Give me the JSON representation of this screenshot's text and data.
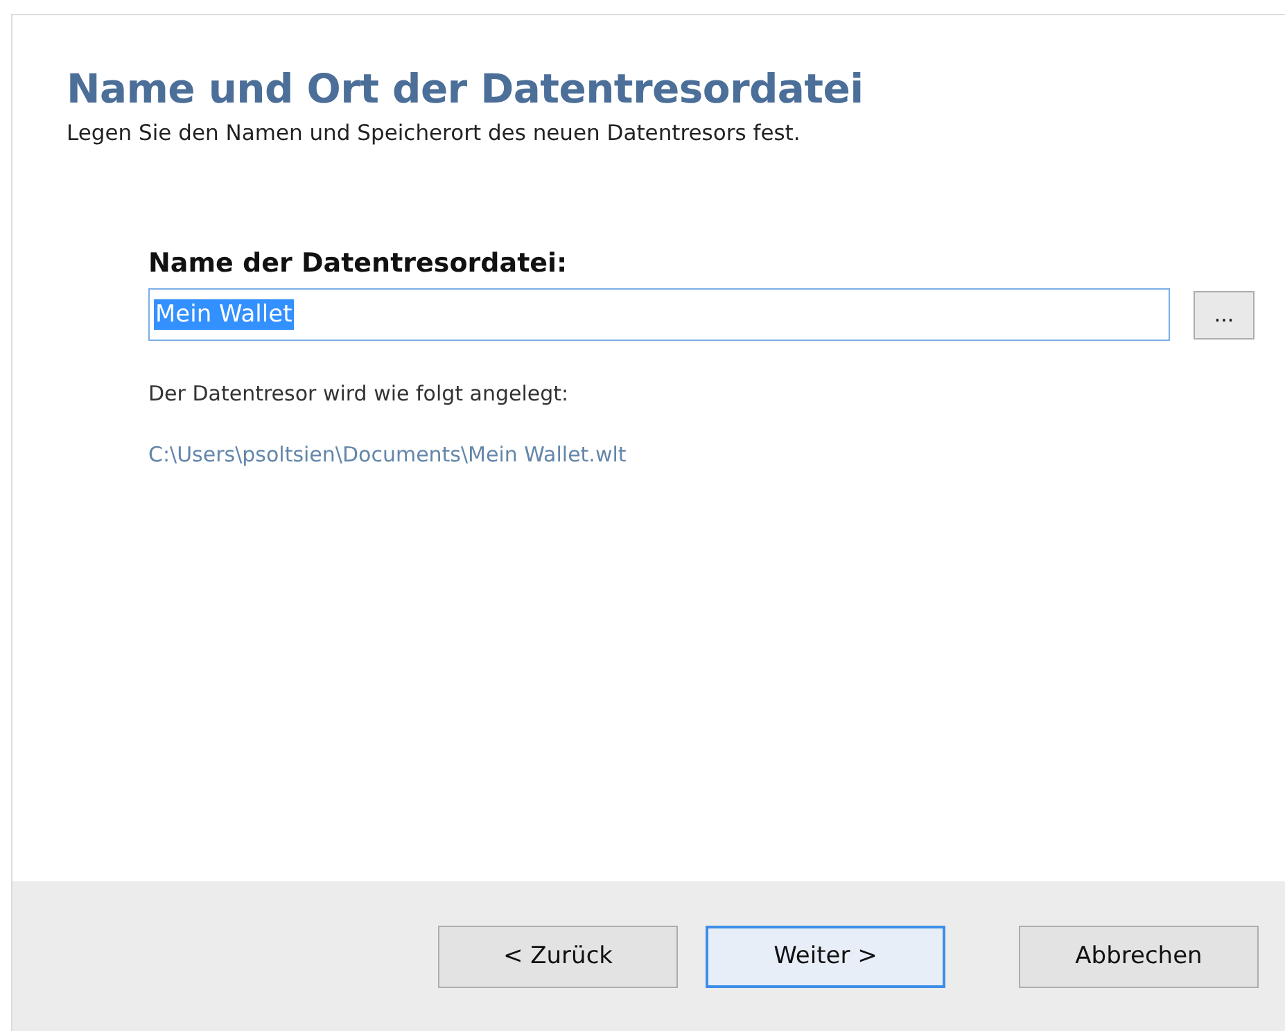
{
  "header": {
    "title": "Name und Ort der Datentresordatei",
    "subtitle": "Legen Sie den Namen und Speicherort des neuen Datentresors fest."
  },
  "form": {
    "label": "Name der Datentresordatei:",
    "field": {
      "value": "Mein Wallet",
      "text_selected": true
    },
    "browse_button": "...",
    "info": "Der Datentresor wird wie folgt angelegt:",
    "path": "C:\\Users\\psoltsien\\Documents\\Mein Wallet.wlt"
  },
  "buttons": [
    {
      "label": "< Zurück",
      "focused": false
    },
    {
      "label": "Weiter >",
      "focused": true
    },
    {
      "label": "Abbrechen",
      "focused": false
    }
  ]
}
